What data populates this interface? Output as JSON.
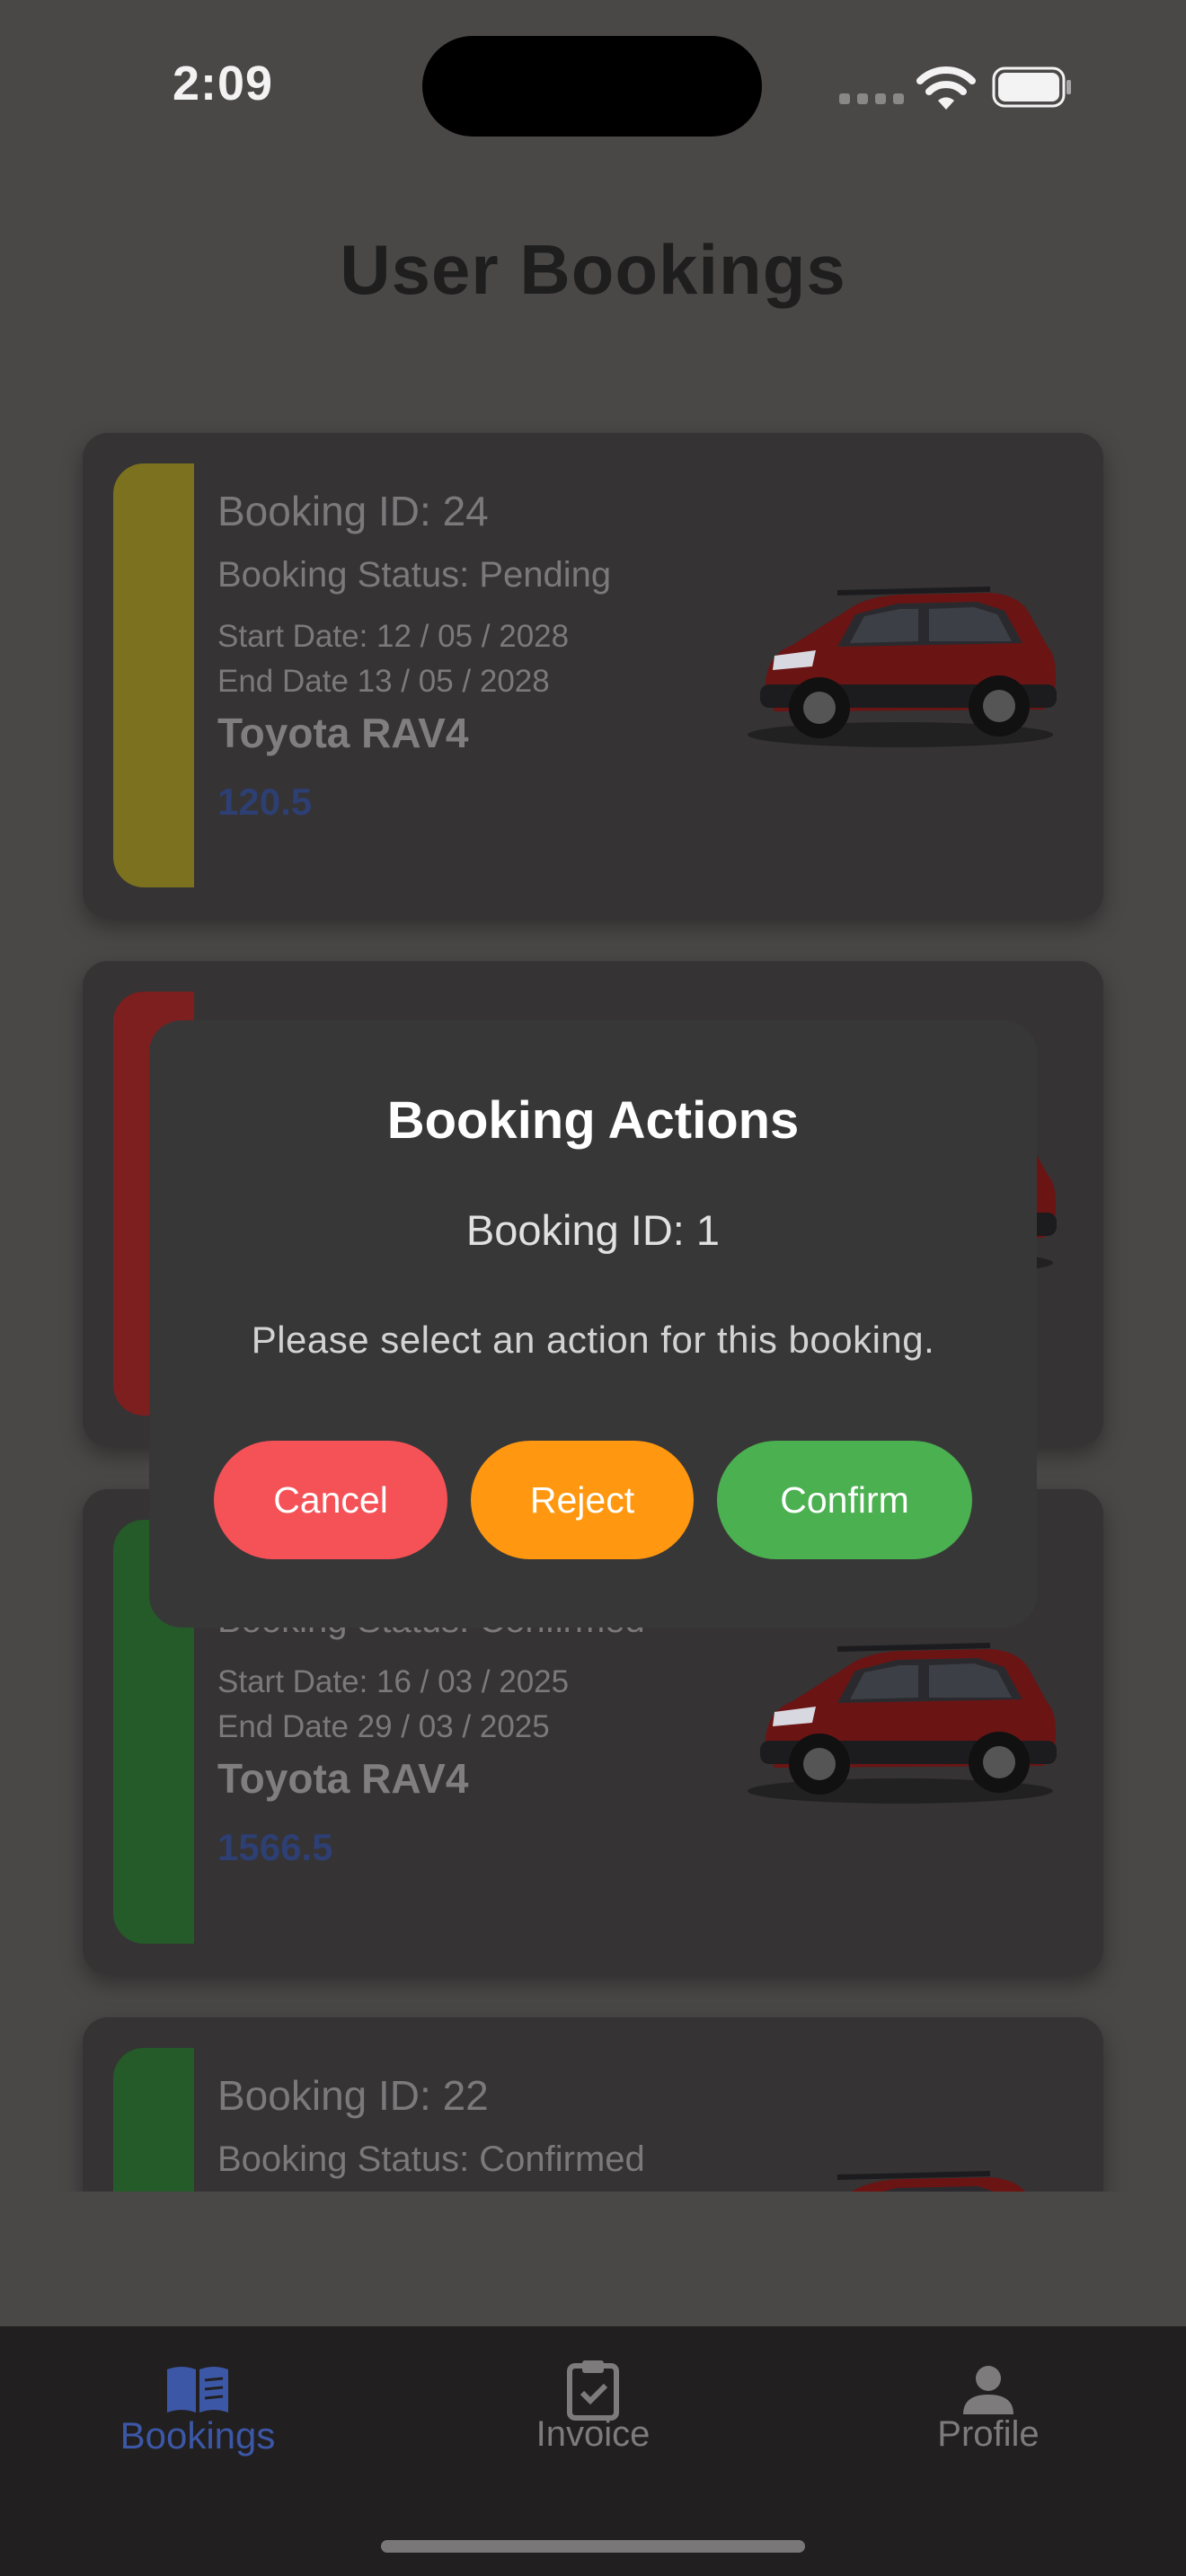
{
  "status_bar": {
    "time": "2:09"
  },
  "page": {
    "title": "User Bookings"
  },
  "bookings": [
    {
      "id_text": "Booking ID: 24",
      "status_text": "Booking Status: Pending",
      "start_text": "Start Date: 12 / 05 / 2028",
      "end_text": "End Date 13 / 05 / 2028",
      "model": "Toyota RAV4",
      "price": "120.5",
      "status_color": "#7b711f"
    },
    {
      "id_text": "",
      "status_text": "",
      "start_text": "",
      "end_text": "",
      "model": "",
      "price": "",
      "status_color": "#7d1f1f"
    },
    {
      "id_text": "",
      "status_text": "Booking Status: Confirmed",
      "start_text": "Start Date: 16 / 03 / 2025",
      "end_text": "End Date 29 / 03 / 2025",
      "model": "Toyota RAV4",
      "price": "1566.5",
      "status_color": "#255a29"
    },
    {
      "id_text": "Booking ID: 22",
      "status_text": "Booking Status: Confirmed",
      "start_text": "",
      "end_text": "",
      "model": "",
      "price": "",
      "status_color": "#255a29"
    }
  ],
  "dialog": {
    "title": "Booking Actions",
    "booking_id_text": "Booking ID: 1",
    "message": "Please select an action for this booking.",
    "cancel_label": "Cancel",
    "reject_label": "Reject",
    "confirm_label": "Confirm",
    "colors": {
      "cancel": "#f55257",
      "reject": "#ff9810",
      "confirm": "#4bb050"
    }
  },
  "tab_bar": {
    "tabs": [
      {
        "label": "Bookings",
        "icon": "book-icon",
        "active": true
      },
      {
        "label": "Invoice",
        "icon": "clipboard-check-icon",
        "active": false
      },
      {
        "label": "Profile",
        "icon": "person-icon",
        "active": false
      }
    ],
    "active_color": "#3b57a6"
  }
}
